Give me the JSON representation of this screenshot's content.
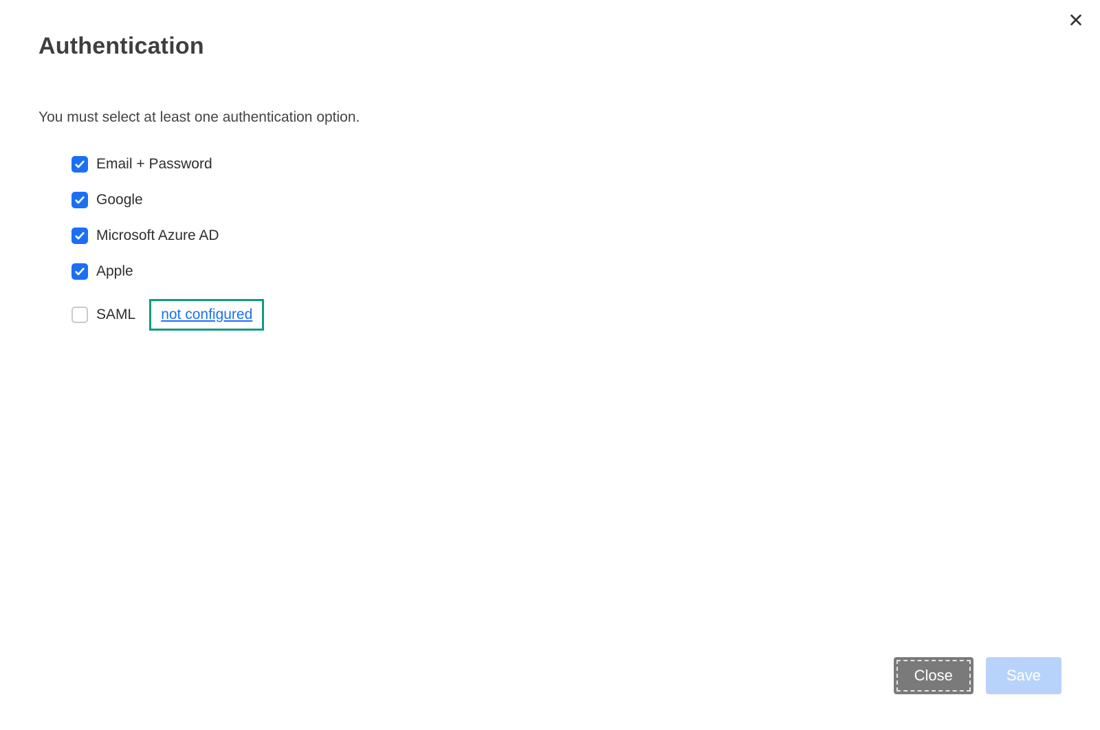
{
  "title": "Authentication",
  "subtitle": "You must select at least one authentication option.",
  "options": {
    "email_password": {
      "label": "Email + Password",
      "checked": true
    },
    "google": {
      "label": "Google",
      "checked": true
    },
    "azure_ad": {
      "label": "Microsoft Azure AD",
      "checked": true
    },
    "apple": {
      "label": "Apple",
      "checked": true
    },
    "saml": {
      "label": "SAML",
      "checked": false,
      "status_link": "not configured"
    }
  },
  "buttons": {
    "close": "Close",
    "save": "Save"
  }
}
